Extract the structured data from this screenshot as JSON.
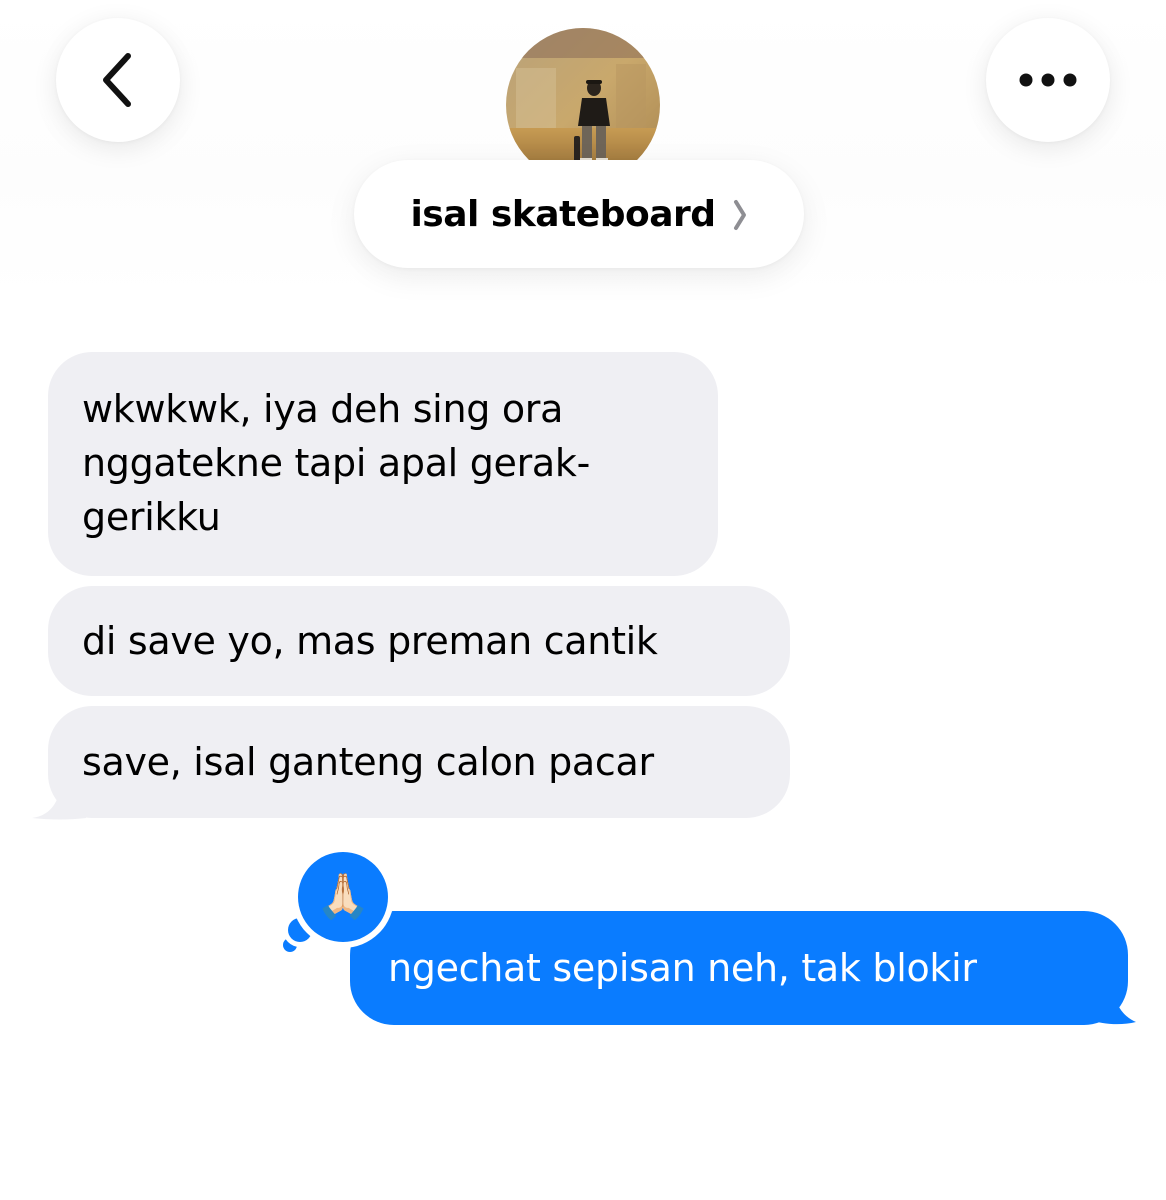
{
  "header": {
    "back_icon": "chevron-left-icon",
    "more_icon": "ellipsis-icon",
    "contact_name": "isal skateboard",
    "contact_chevron_icon": "chevron-right-icon",
    "avatar_icon": "profile-photo"
  },
  "messages": [
    {
      "direction": "incoming",
      "text": "wkwkwk, iya deh sing ora nggatekne tapi apal gerak-gerikku"
    },
    {
      "direction": "incoming",
      "text": "di save yo, mas preman cantik"
    },
    {
      "direction": "incoming",
      "text": "save, isal ganteng calon pacar"
    },
    {
      "direction": "outgoing",
      "text": "ngechat sepisan neh, tak blokir",
      "reaction": "🙏🏻"
    }
  ],
  "colors": {
    "incoming_bubble": "#efeff3",
    "outgoing_bubble": "#0a7cff",
    "background": "#ffffff"
  }
}
